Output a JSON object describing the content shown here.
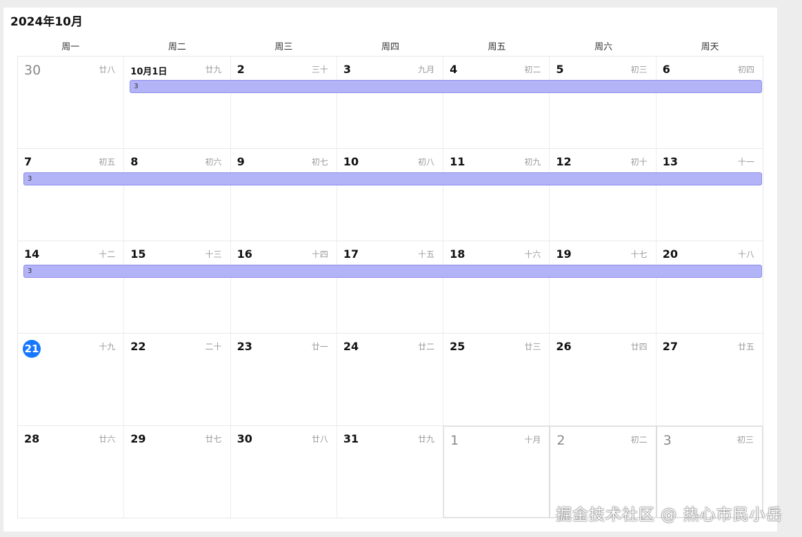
{
  "calendar": {
    "title": "2024年10月",
    "weekdays": [
      "周一",
      "周二",
      "周三",
      "周四",
      "周五",
      "周六",
      "周天"
    ],
    "event_label": "3",
    "weeks": [
      [
        {
          "day": "30",
          "lunar": "廿八",
          "other": true
        },
        {
          "day": "10月1日",
          "lunar": "廿九",
          "first": true
        },
        {
          "day": "2",
          "lunar": "三十"
        },
        {
          "day": "3",
          "lunar": "九月"
        },
        {
          "day": "4",
          "lunar": "初二"
        },
        {
          "day": "5",
          "lunar": "初三"
        },
        {
          "day": "6",
          "lunar": "初四"
        }
      ],
      [
        {
          "day": "7",
          "lunar": "初五"
        },
        {
          "day": "8",
          "lunar": "初六"
        },
        {
          "day": "9",
          "lunar": "初七"
        },
        {
          "day": "10",
          "lunar": "初八"
        },
        {
          "day": "11",
          "lunar": "初九"
        },
        {
          "day": "12",
          "lunar": "初十"
        },
        {
          "day": "13",
          "lunar": "十一"
        }
      ],
      [
        {
          "day": "14",
          "lunar": "十二"
        },
        {
          "day": "15",
          "lunar": "十三"
        },
        {
          "day": "16",
          "lunar": "十四"
        },
        {
          "day": "17",
          "lunar": "十五"
        },
        {
          "day": "18",
          "lunar": "十六"
        },
        {
          "day": "19",
          "lunar": "十七"
        },
        {
          "day": "20",
          "lunar": "十八"
        }
      ],
      [
        {
          "day": "21",
          "lunar": "十九",
          "today": true
        },
        {
          "day": "22",
          "lunar": "二十"
        },
        {
          "day": "23",
          "lunar": "廿一"
        },
        {
          "day": "24",
          "lunar": "廿二"
        },
        {
          "day": "25",
          "lunar": "廿三"
        },
        {
          "day": "26",
          "lunar": "廿四"
        },
        {
          "day": "27",
          "lunar": "廿五"
        }
      ],
      [
        {
          "day": "28",
          "lunar": "廿六"
        },
        {
          "day": "29",
          "lunar": "廿七"
        },
        {
          "day": "30",
          "lunar": "廿八"
        },
        {
          "day": "31",
          "lunar": "廿九"
        },
        {
          "day": "1",
          "lunar": "十月",
          "other": true
        },
        {
          "day": "2",
          "lunar": "初二",
          "other": true
        },
        {
          "day": "3",
          "lunar": "初三",
          "other": true
        }
      ]
    ]
  },
  "watermark": "掘金技术社区 @ 热心市民小岳"
}
